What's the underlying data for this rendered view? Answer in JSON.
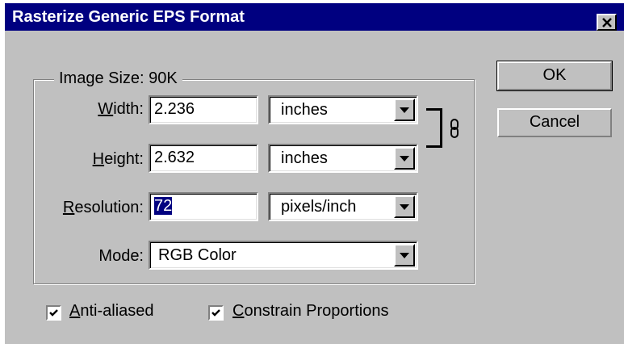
{
  "title": "Rasterize Generic EPS Format",
  "close_glyph": "✕",
  "image_size_label": "Image Size: 90K",
  "width": {
    "label_mnemonic": "W",
    "label_rest": "idth:",
    "value": "2.236",
    "unit": "inches"
  },
  "height": {
    "label_mnemonic": "H",
    "label_rest": "eight:",
    "value": "2.632",
    "unit": "inches"
  },
  "resolution": {
    "label_mnemonic": "R",
    "label_rest": "esolution:",
    "value": "72",
    "unit": "pixels/inch"
  },
  "mode": {
    "label": "Mode:",
    "value": "RGB Color"
  },
  "ok_label": "OK",
  "cancel_label": "Cancel",
  "anti_aliased": {
    "mnemonic": "A",
    "rest": "nti-aliased",
    "checked": true
  },
  "constrain": {
    "mnemonic": "C",
    "rest": "onstrain Proportions",
    "checked": true
  },
  "colors": {
    "titlebar": "#000080",
    "face": "#c0c0c0",
    "selection": "#000080"
  }
}
